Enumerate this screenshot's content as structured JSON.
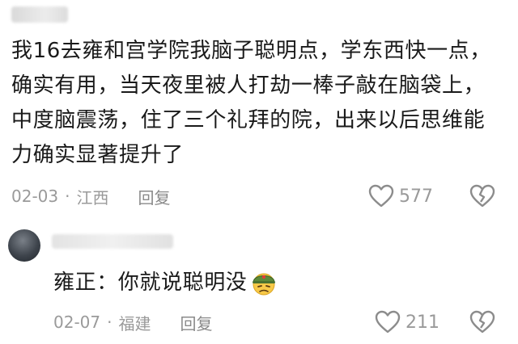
{
  "comment": {
    "text": "我16去雍和宫学院我脑子聪明点，学东西快一点，确实有用，当天夜里被人打劫一棒子敲在脑袋上，中度脑震荡，住了三个礼拜的院，出来以后思维能力确实显著提升了",
    "date": "02-03",
    "separator": "·",
    "location": "江西",
    "reply_label": "回复",
    "likes": "577"
  },
  "reply": {
    "text": "雍正：你就说聪明没",
    "emoji_icon": "soldier-emoji-icon",
    "date": "02-07",
    "separator": "·",
    "location": "福建",
    "reply_label": "回复",
    "likes": "211"
  },
  "colors": {
    "text": "#1a1a1a",
    "meta": "#9a9a9a",
    "icon": "#8c8c8c"
  }
}
